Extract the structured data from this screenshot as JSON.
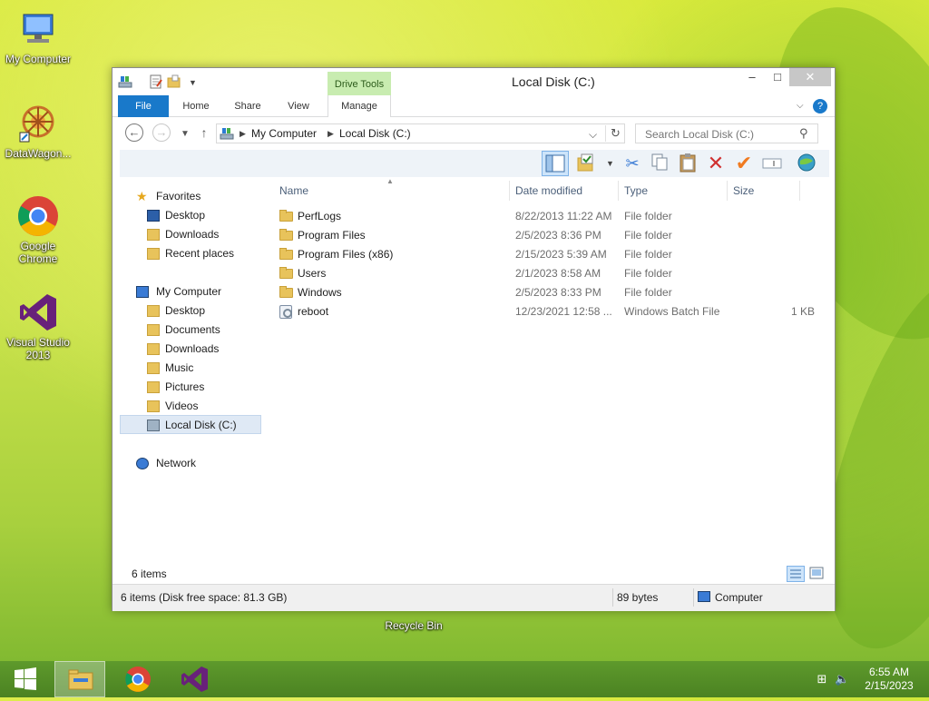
{
  "desktop": {
    "icons": [
      {
        "label": "My Computer"
      },
      {
        "label": "DataWagon..."
      },
      {
        "label": "Google Chrome"
      },
      {
        "label": "Visual Studio 2013"
      },
      {
        "label": "Recycle Bin"
      }
    ]
  },
  "window": {
    "title": "Local Disk (C:)",
    "context_tab_group": "Drive Tools",
    "tabs": {
      "file": "File",
      "home": "Home",
      "share": "Share",
      "view": "View",
      "manage": "Manage"
    },
    "controls": {
      "minimize": "–",
      "maximize": "□",
      "close": "✕"
    }
  },
  "address": {
    "crumbs": [
      "My Computer",
      "Local Disk (C:)"
    ],
    "search_placeholder": "Search Local Disk (C:)"
  },
  "navpane": {
    "favorites": {
      "label": "Favorites",
      "items": [
        "Desktop",
        "Downloads",
        "Recent places"
      ]
    },
    "computer": {
      "label": "My Computer",
      "items": [
        "Desktop",
        "Documents",
        "Downloads",
        "Music",
        "Pictures",
        "Videos",
        "Local Disk (C:)"
      ]
    },
    "network": {
      "label": "Network"
    }
  },
  "columns": {
    "name": "Name",
    "date": "Date modified",
    "type": "Type",
    "size": "Size"
  },
  "files": [
    {
      "name": "PerfLogs",
      "date": "8/22/2013 11:22 AM",
      "type": "File folder",
      "size": "",
      "kind": "folder"
    },
    {
      "name": "Program Files",
      "date": "2/5/2023 8:36 PM",
      "type": "File folder",
      "size": "",
      "kind": "folder"
    },
    {
      "name": "Program Files (x86)",
      "date": "2/15/2023 5:39 AM",
      "type": "File folder",
      "size": "",
      "kind": "folder"
    },
    {
      "name": "Users",
      "date": "2/1/2023 8:58 AM",
      "type": "File folder",
      "size": "",
      "kind": "folder"
    },
    {
      "name": "Windows",
      "date": "2/5/2023 8:33 PM",
      "type": "File folder",
      "size": "",
      "kind": "folder"
    },
    {
      "name": "reboot",
      "date": "12/23/2021 12:58 ...",
      "type": "Windows Batch File",
      "size": "1 KB",
      "kind": "batch"
    }
  ],
  "status": {
    "item_count": "6 items",
    "details": "6 items (Disk free space: 81.3 GB)",
    "bytes": "89 bytes",
    "location": "Computer"
  },
  "taskbar": {
    "clock_time": "6:55 AM",
    "clock_date": "2/15/2023"
  },
  "colors": {
    "accent": "#1979ca",
    "context_tab": "#c8ecb0",
    "folder": "#e8c35b"
  }
}
